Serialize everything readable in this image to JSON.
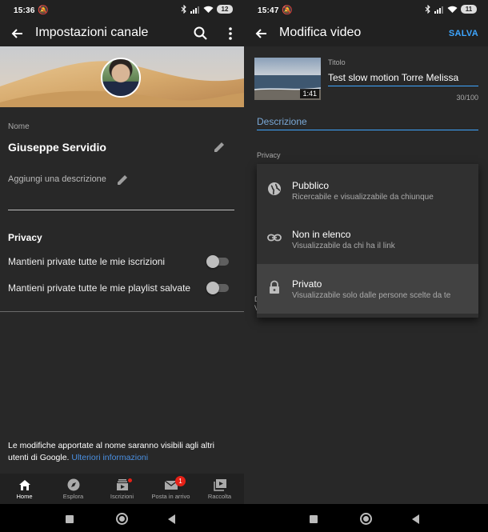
{
  "left": {
    "status": {
      "time": "15:36",
      "battery": "12"
    },
    "appbar": {
      "title": "Impostazioni canale"
    },
    "name_label": "Nome",
    "name_value": "Giuseppe Servidio",
    "description_placeholder": "Aggiungi una descrizione",
    "privacy_title": "Privacy",
    "toggles": [
      {
        "label": "Mantieni private tutte le mie iscrizioni",
        "on": false
      },
      {
        "label": "Mantieni private tutte le mie playlist salvate",
        "on": false
      }
    ],
    "footer_text": "Le modifiche apportate al nome saranno visibili agli altri utenti di Google.",
    "footer_link": "Ulteriori informazioni",
    "bottom_nav": [
      {
        "label": "Home",
        "icon": "home-icon"
      },
      {
        "label": "Esplora",
        "icon": "explore-icon"
      },
      {
        "label": "Iscrizioni",
        "icon": "subscriptions-icon"
      },
      {
        "label": "Posta in arrivo",
        "icon": "inbox-icon",
        "badge": "1"
      },
      {
        "label": "Raccolta",
        "icon": "library-icon"
      }
    ]
  },
  "right": {
    "status": {
      "time": "15:47",
      "battery": "11"
    },
    "appbar": {
      "title": "Modifica video",
      "save_label": "SALVA"
    },
    "thumbnail_duration": "1:41",
    "title_label": "Titolo",
    "title_value": "Test slow motion Torre Melissa",
    "title_counter": "30/100",
    "description_placeholder": "Descrizione",
    "privacy_label": "Privacy",
    "privacy_options": [
      {
        "title": "Pubblico",
        "subtitle": "Ricercabile e visualizzabile da chiunque",
        "icon": "globe-icon",
        "selected": false
      },
      {
        "title": "Non in elenco",
        "subtitle": "Visualizzabile da chi ha il link",
        "icon": "link-icon",
        "selected": false
      },
      {
        "title": "Privato",
        "subtitle": "Visualizzabile solo dalle persone scelte da te",
        "icon": "lock-icon",
        "selected": true
      }
    ],
    "peek_letters": [
      "D",
      "V"
    ]
  },
  "colors": {
    "accent": "#3ea6ff",
    "badge": "#e62117",
    "background": "#282828",
    "bar": "#212121"
  }
}
